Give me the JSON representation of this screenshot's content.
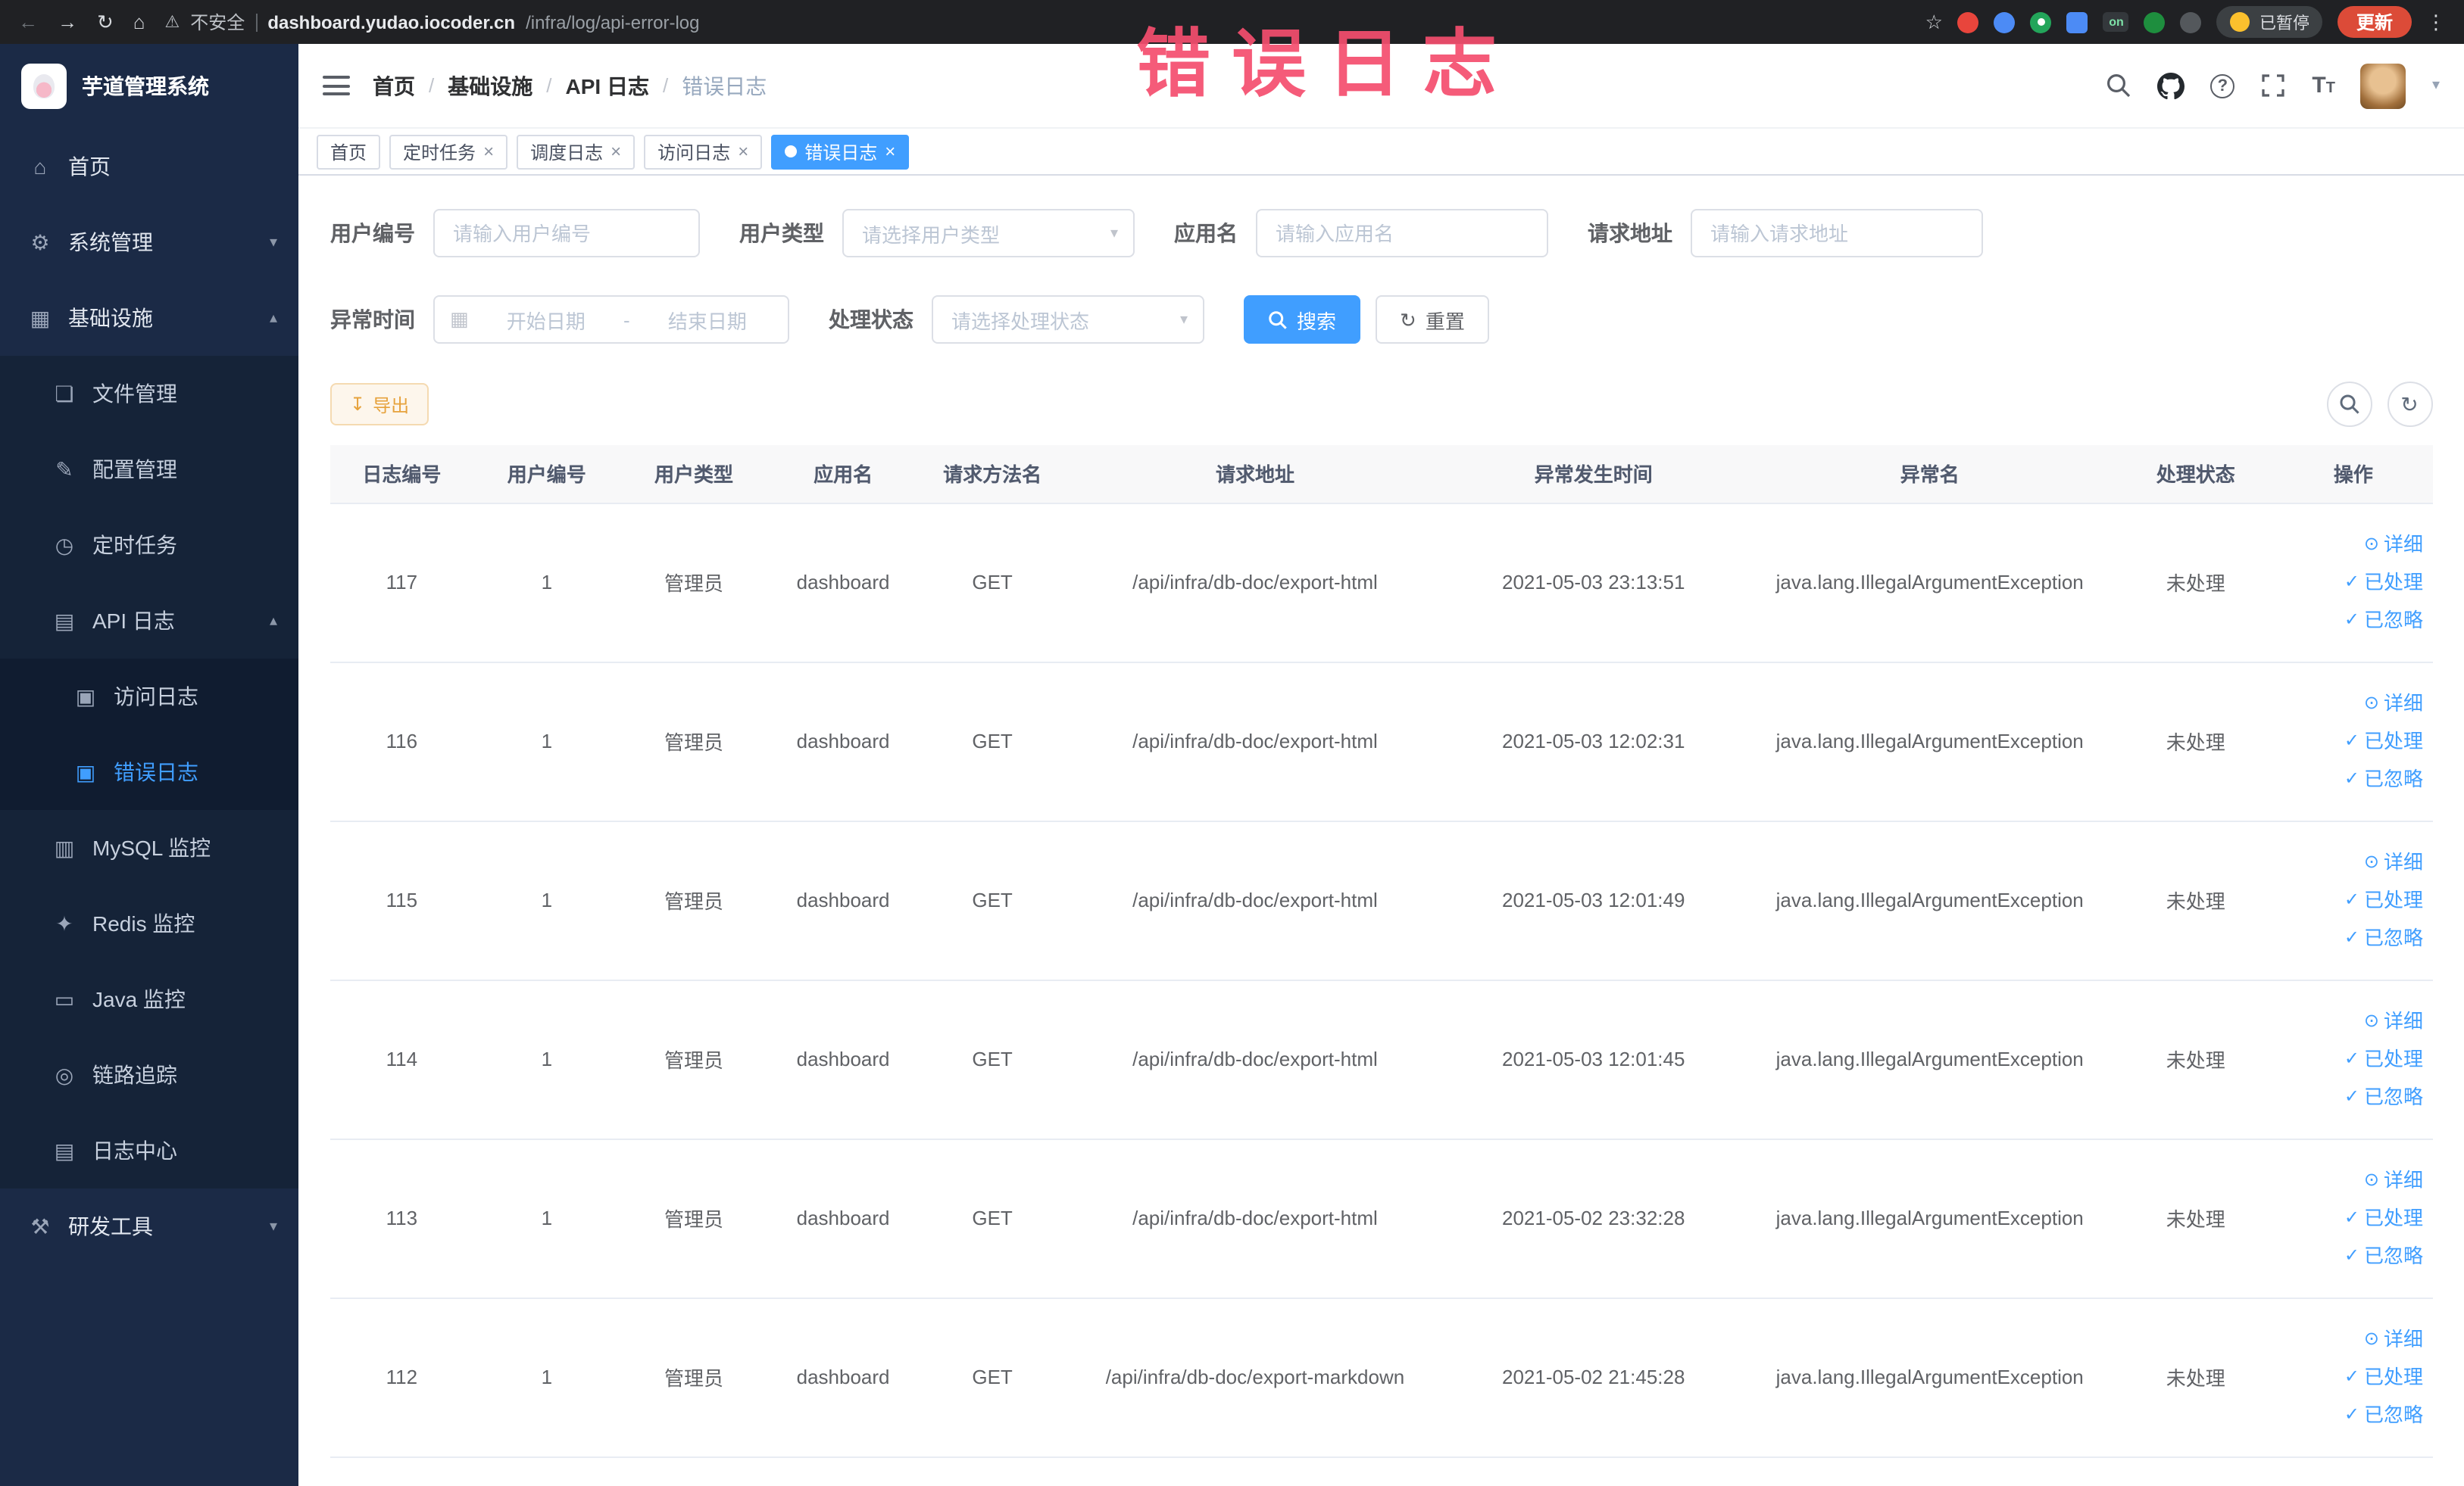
{
  "browser": {
    "security_label": "不安全",
    "url_domain": "dashboard.yudao.iocoder.cn",
    "url_path": "/infra/log/api-error-log",
    "on_badge": "on",
    "paused_badge": "已暂停",
    "update_button": "更新"
  },
  "annotation": {
    "text": "错误日志"
  },
  "sidebar": {
    "logo_title": "芋道管理系统",
    "items": [
      {
        "key": "home",
        "label": "首页",
        "icon": "home-icon",
        "level": 1
      },
      {
        "key": "system-management",
        "label": "系统管理",
        "icon": "gear-icon",
        "level": 1,
        "chevron": "down"
      },
      {
        "key": "infrastructure",
        "label": "基础设施",
        "icon": "grid-icon",
        "level": 1,
        "chevron": "up"
      },
      {
        "key": "file-management",
        "label": "文件管理",
        "icon": "folder-icon",
        "level": 2
      },
      {
        "key": "config-management",
        "label": "配置管理",
        "icon": "edit-icon",
        "level": 2
      },
      {
        "key": "scheduled-tasks",
        "label": "定时任务",
        "icon": "clock-icon",
        "level": 2
      },
      {
        "key": "api-log",
        "label": "API 日志",
        "icon": "log-icon",
        "level": 2,
        "chevron": "up"
      },
      {
        "key": "access-log",
        "label": "访问日志",
        "icon": "doc-edit-icon",
        "level": 3
      },
      {
        "key": "error-log",
        "label": "错误日志",
        "icon": "doc-edit-icon",
        "level": 3,
        "active": true
      },
      {
        "key": "mysql-monitor",
        "label": "MySQL 监控",
        "icon": "database-icon",
        "level": 2
      },
      {
        "key": "redis-monitor",
        "label": "Redis 监控",
        "icon": "redis-icon",
        "level": 2
      },
      {
        "key": "java-monitor",
        "label": "Java 监控",
        "icon": "java-icon",
        "level": 2
      },
      {
        "key": "link-trace",
        "label": "链路追踪",
        "icon": "trace-icon",
        "level": 2
      },
      {
        "key": "log-center",
        "label": "日志中心",
        "icon": "log-center-icon",
        "level": 2
      },
      {
        "key": "dev-tools",
        "label": "研发工具",
        "icon": "tool-icon",
        "level": 1,
        "chevron": "down"
      }
    ]
  },
  "header": {
    "breadcrumb": [
      "首页",
      "基础设施",
      "API 日志",
      "错误日志"
    ],
    "separator": "/"
  },
  "tabs": [
    {
      "key": "home",
      "label": "首页",
      "closable": false,
      "active": false
    },
    {
      "key": "scheduled-tasks",
      "label": "定时任务",
      "closable": true,
      "active": false
    },
    {
      "key": "schedule-log",
      "label": "调度日志",
      "closable": true,
      "active": false
    },
    {
      "key": "access-log",
      "label": "访问日志",
      "closable": true,
      "active": false
    },
    {
      "key": "error-log",
      "label": "错误日志",
      "closable": true,
      "active": true
    }
  ],
  "filters": {
    "user_id": {
      "label": "用户编号",
      "placeholder": "请输入用户编号"
    },
    "user_type": {
      "label": "用户类型",
      "placeholder": "请选择用户类型"
    },
    "app_name": {
      "label": "应用名",
      "placeholder": "请输入应用名"
    },
    "request_url": {
      "label": "请求地址",
      "placeholder": "请输入请求地址"
    },
    "exception_time": {
      "label": "异常时间",
      "start_placeholder": "开始日期",
      "separator": "-",
      "end_placeholder": "结束日期"
    },
    "process_status": {
      "label": "处理状态",
      "placeholder": "请选择处理状态"
    },
    "search_button": "搜索",
    "reset_button": "重置"
  },
  "toolbar": {
    "export_button": "导出"
  },
  "table": {
    "columns": [
      "日志编号",
      "用户编号",
      "用户类型",
      "应用名",
      "请求方法名",
      "请求地址",
      "异常发生时间",
      "异常名",
      "处理状态",
      "操作"
    ],
    "row_actions": [
      {
        "key": "detail",
        "label": "详细",
        "icon": "eye-icon"
      },
      {
        "key": "processed",
        "label": "已处理",
        "icon": "check-icon"
      },
      {
        "key": "ignored",
        "label": "已忽略",
        "icon": "check-icon"
      }
    ],
    "rows": [
      {
        "id": "117",
        "user_id": "1",
        "user_type": "管理员",
        "app": "dashboard",
        "method": "GET",
        "url": "/api/infra/db-doc/export-html",
        "time": "2021-05-03 23:13:51",
        "exception": "java.lang.IllegalArgumentException",
        "status": "未处理"
      },
      {
        "id": "116",
        "user_id": "1",
        "user_type": "管理员",
        "app": "dashboard",
        "method": "GET",
        "url": "/api/infra/db-doc/export-html",
        "time": "2021-05-03 12:02:31",
        "exception": "java.lang.IllegalArgumentException",
        "status": "未处理"
      },
      {
        "id": "115",
        "user_id": "1",
        "user_type": "管理员",
        "app": "dashboard",
        "method": "GET",
        "url": "/api/infra/db-doc/export-html",
        "time": "2021-05-03 12:01:49",
        "exception": "java.lang.IllegalArgumentException",
        "status": "未处理"
      },
      {
        "id": "114",
        "user_id": "1",
        "user_type": "管理员",
        "app": "dashboard",
        "method": "GET",
        "url": "/api/infra/db-doc/export-html",
        "time": "2021-05-03 12:01:45",
        "exception": "java.lang.IllegalArgumentException",
        "status": "未处理"
      },
      {
        "id": "113",
        "user_id": "1",
        "user_type": "管理员",
        "app": "dashboard",
        "method": "GET",
        "url": "/api/infra/db-doc/export-html",
        "time": "2021-05-02 23:32:28",
        "exception": "java.lang.IllegalArgumentException",
        "status": "未处理"
      },
      {
        "id": "112",
        "user_id": "1",
        "user_type": "管理员",
        "app": "dashboard",
        "method": "GET",
        "url": "/api/infra/db-doc/export-markdown",
        "time": "2021-05-02 21:45:28",
        "exception": "java.lang.IllegalArgumentException",
        "status": "未处理"
      }
    ]
  },
  "colors": {
    "accent": "#409eff",
    "sidebar_bg": "#1b2a46",
    "warning": "#e6a23c",
    "annotation": "#f54e6e"
  }
}
